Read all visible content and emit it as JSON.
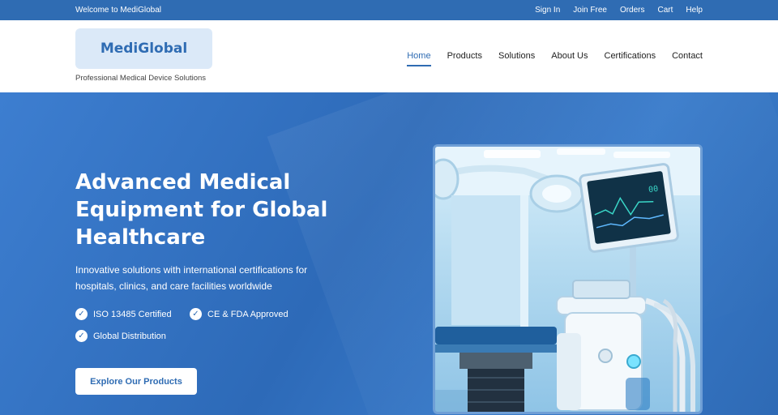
{
  "topbar": {
    "welcome": "Welcome to MediGlobal",
    "links": [
      "Sign In",
      "Join Free",
      "Orders",
      "Cart",
      "Help"
    ]
  },
  "header": {
    "logo": "MediGlobal",
    "tagline": "Professional Medical Device Solutions",
    "nav": [
      "Home",
      "Products",
      "Solutions",
      "About Us",
      "Certifications",
      "Contact"
    ],
    "active_nav": "Home"
  },
  "hero": {
    "title": "Advanced Medical Equipment for Global Healthcare",
    "subtitle": "Innovative solutions with international certifications for hospitals, clinics, and care facilities worldwide",
    "features": [
      "ISO 13485 Certified",
      "CE & FDA Approved",
      "Global Distribution"
    ],
    "cta": "Explore Our Products"
  },
  "colors": {
    "brand": "#2f6cb3",
    "logo_bg": "#dbe9f8"
  }
}
